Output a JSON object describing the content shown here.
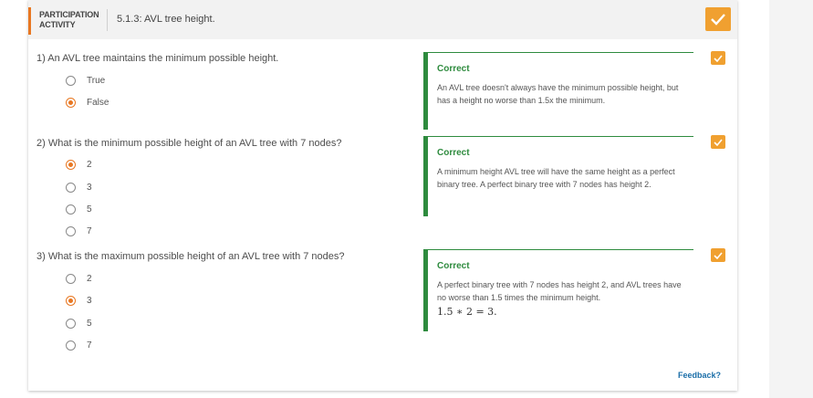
{
  "header": {
    "activity_type": "PARTICIPATION ACTIVITY",
    "title": "5.1.3: AVL tree height.",
    "accent_color": "#e87722",
    "complete_icon": "check-icon"
  },
  "questions": [
    {
      "prompt": "1) An AVL tree maintains the minimum possible height.",
      "options": [
        {
          "label": "True",
          "selected": false
        },
        {
          "label": "False",
          "selected": true
        }
      ],
      "feedback": {
        "status": "Correct",
        "text": "An AVL tree doesn't always have the minimum possible height, but has a height no worse than 1.5x the minimum.",
        "math": ""
      }
    },
    {
      "prompt": "2) What is the minimum possible height of an AVL tree with 7 nodes?",
      "options": [
        {
          "label": "2",
          "selected": true
        },
        {
          "label": "3",
          "selected": false
        },
        {
          "label": "5",
          "selected": false
        },
        {
          "label": "7",
          "selected": false
        }
      ],
      "feedback": {
        "status": "Correct",
        "text": "A minimum height AVL tree will have the same height as a perfect binary tree. A perfect binary tree with 7 nodes has height 2.",
        "math": ""
      }
    },
    {
      "prompt": "3) What is the maximum possible height of an AVL tree with 7 nodes?",
      "options": [
        {
          "label": "2",
          "selected": false
        },
        {
          "label": "3",
          "selected": true
        },
        {
          "label": "5",
          "selected": false
        },
        {
          "label": "7",
          "selected": false
        }
      ],
      "feedback": {
        "status": "Correct",
        "text": "A perfect binary tree with 7 nodes has height 2, and AVL trees have no worse than 1.5 times the minimum height.",
        "math": "1.5 ∗ 2 = 3."
      }
    }
  ],
  "feedback_link": "Feedback?",
  "colors": {
    "correct": "#2e8b3e",
    "check_bg": "#f0a030"
  }
}
